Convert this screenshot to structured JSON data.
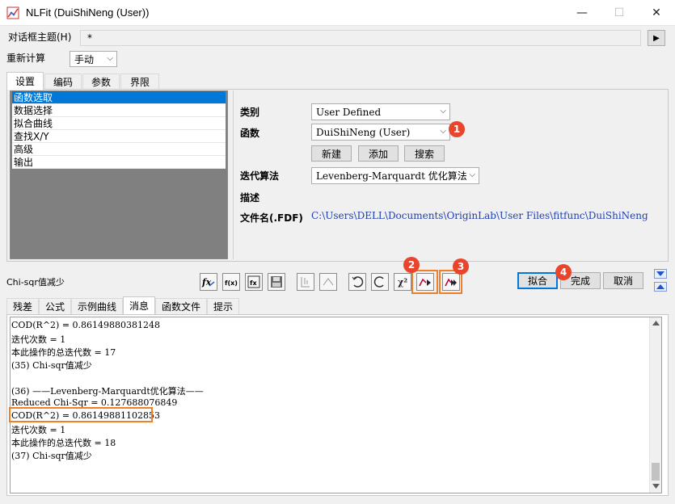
{
  "window": {
    "title": "NLFit (DuiShiNeng (User))",
    "minimize_glyph": "—",
    "maximize_glyph": "☐",
    "close_glyph": "✕"
  },
  "dialog_theme": {
    "label": "对话框主题(H)",
    "value": "*",
    "arrow": "▶"
  },
  "recalc": {
    "label": "重新计算",
    "value": "手动"
  },
  "top_tabs": [
    "设置",
    "编码",
    "参数",
    "界限"
  ],
  "tree": [
    "函数选取",
    "数据选择",
    "拟合曲线",
    "查找X/Y",
    "高级",
    "输出"
  ],
  "form": {
    "category_label": "类别",
    "category_value": "User Defined",
    "function_label": "函数",
    "function_value": "DuiShiNeng (User)",
    "btn_new": "新建",
    "btn_add": "添加",
    "btn_search": "搜索",
    "algo_label": "迭代算法",
    "algo_value": "Levenberg-Marquardt 优化算法",
    "desc_label": "描述",
    "file_label": "文件名(.FDF)",
    "file_value": "C:\\Users\\DELL\\Documents\\OriginLab\\User Files\\fitfunc\\DuiShiNeng"
  },
  "status_text": "Chi-sqr值减少",
  "toolbar": {
    "chi2_label": "χ²",
    "fit_button": "拟合",
    "done_button": "完成",
    "cancel_button": "取消"
  },
  "badges": [
    "1",
    "2",
    "3",
    "4"
  ],
  "bottom_tabs": [
    "残差",
    "公式",
    "示例曲线",
    "消息",
    "函数文件",
    "提示"
  ],
  "messages": [
    "COD(R^2) = 0.86149880381248",
    "迭代次数 = 1",
    "本此操作的总迭代数 = 17",
    "(35) Chi-sqr值减少",
    "",
    "(36) ——Levenberg-Marquardt优化算法——",
    "Reduced Chi-Sqr = 0.127688076849",
    "COD(R^2) = 0.86149881102853",
    "迭代次数 = 1",
    "本此操作的总迭代数 = 18",
    "(37) Chi-sqr值减少"
  ],
  "colors": {
    "accent": "#0078d7",
    "highlight": "#f07f29",
    "badge": "#e8452c",
    "file_path": "#1f3fae"
  }
}
